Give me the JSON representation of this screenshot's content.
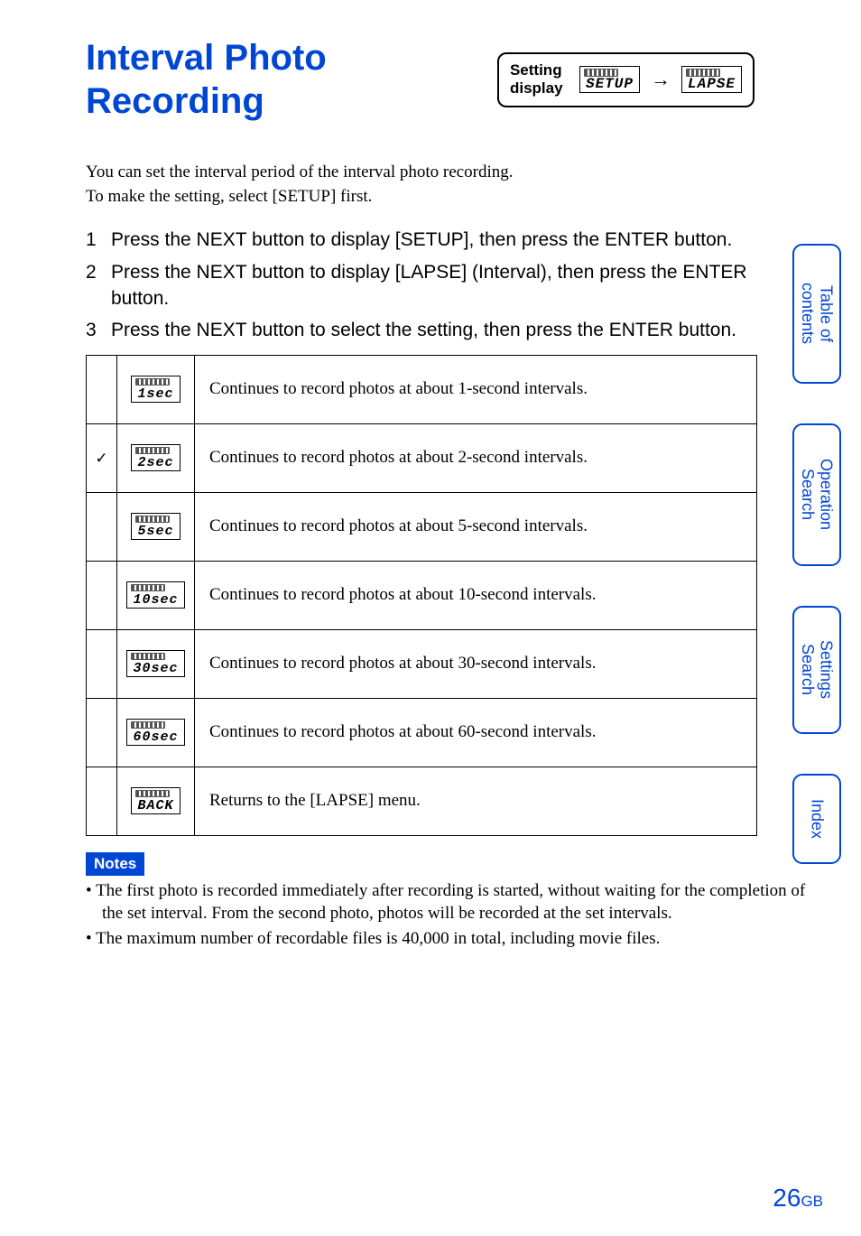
{
  "title": "Interval Photo Recording",
  "setting_display": {
    "label": "Setting display",
    "left_lcd": "SETUP",
    "right_lcd": "LAPSE",
    "arrow": "→"
  },
  "intro": {
    "line1": "You can set the interval period of the interval photo recording.",
    "line2": "To make the setting, select [SETUP] first."
  },
  "steps": [
    "Press the NEXT button to display [SETUP], then press the ENTER button.",
    "Press the NEXT button to display [LAPSE] (Interval), then press the ENTER button.",
    "Press the NEXT button to select the setting, then press the ENTER button."
  ],
  "table": [
    {
      "check": "",
      "lcd": "1sec",
      "desc": "Continues to record photos at about 1-second intervals."
    },
    {
      "check": "✓",
      "lcd": "2sec",
      "desc": "Continues to record photos at about 2-second intervals."
    },
    {
      "check": "",
      "lcd": "5sec",
      "desc": "Continues to record photos at about 5-second intervals."
    },
    {
      "check": "",
      "lcd": "10sec",
      "desc": "Continues to record photos at about 10-second intervals."
    },
    {
      "check": "",
      "lcd": "30sec",
      "desc": "Continues to record photos at about 30-second intervals."
    },
    {
      "check": "",
      "lcd": "60sec",
      "desc": "Continues to record photos at about 60-second intervals."
    },
    {
      "check": "",
      "lcd": "BACK",
      "desc": "Returns to the [LAPSE] menu."
    }
  ],
  "notes": {
    "label": "Notes",
    "items": [
      "The first photo is recorded immediately after recording is started, without waiting for the completion of the set interval. From the second photo, photos will be recorded at the set intervals.",
      "The maximum number of recordable files is 40,000 in total, including movie files."
    ]
  },
  "side_tabs": [
    "Table of\ncontents",
    "Operation\nSearch",
    "Settings\nSearch",
    "Index"
  ],
  "page": {
    "number": "26",
    "suffix": "GB"
  }
}
